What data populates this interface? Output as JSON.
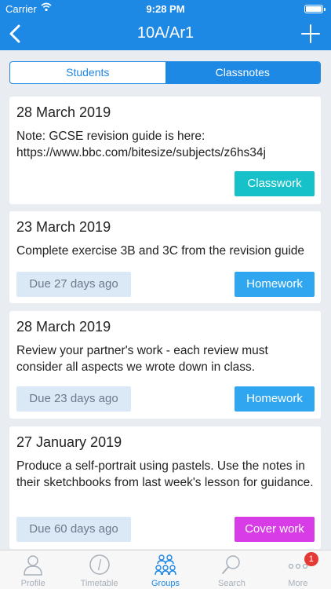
{
  "status_bar": {
    "carrier": "Carrier",
    "time": "9:28 PM"
  },
  "nav": {
    "title": "10A/Ar1"
  },
  "segments": [
    "Students",
    "Classnotes"
  ],
  "cards": [
    {
      "date": "28 March 2019",
      "note": "Note: GCSE revision guide is here: https://www.bbc.com/bitesize/subjects/z6hs34j",
      "type": "Classwork"
    },
    {
      "date": "23 March 2019",
      "note": "Complete exercise 3B and 3C from the revision guide",
      "due": "Due 27 days ago",
      "type": "Homework"
    },
    {
      "date": "28 March 2019",
      "note": "Review your partner's work - each review must consider all aspects we wrote down in class.",
      "due": "Due 23 days ago",
      "type": "Homework"
    },
    {
      "date": "27 January 2019",
      "note": "Produce a self-portrait using pastels. Use the notes in their sketchbooks from last week's lesson for guidance.",
      "due": "Due 60 days ago",
      "type": "Cover work"
    }
  ],
  "tabs": [
    {
      "label": "Profile",
      "icon": "profile-icon"
    },
    {
      "label": "Timetable",
      "icon": "clock-icon"
    },
    {
      "label": "Groups",
      "icon": "groups-icon"
    },
    {
      "label": "Search",
      "icon": "search-icon"
    },
    {
      "label": "More",
      "icon": "more-icon",
      "badge": "1"
    }
  ],
  "colors": {
    "accent": "#1e88e5",
    "classwork": "#17c1c9",
    "homework": "#2fa6ef",
    "cover": "#d83ce6",
    "badge": "#e53935"
  }
}
